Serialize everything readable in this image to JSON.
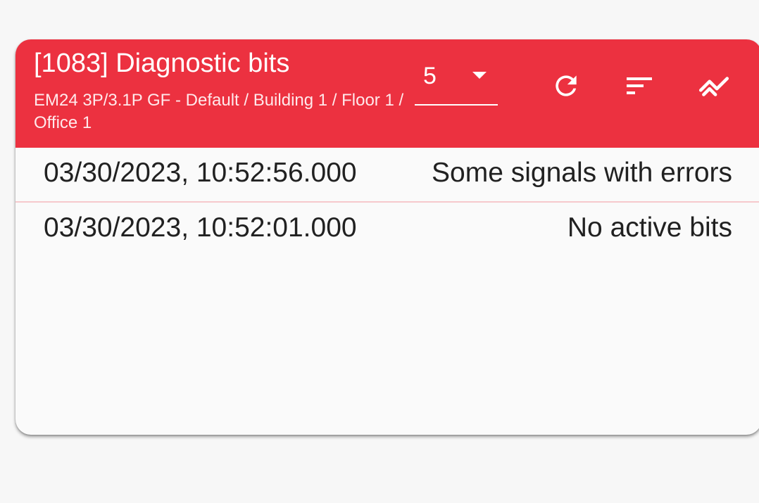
{
  "widget": {
    "title": "[1083] Diagnostic bits",
    "subtitle": "EM24 3P/3.1P GF - Default / Building 1 / Floor 1 / Office 1",
    "header_color": "#ec3140",
    "rows_select": {
      "selected": "5"
    },
    "icons": {
      "refresh": "refresh-icon",
      "sort": "sort-icon",
      "trend": "trend-icon"
    }
  },
  "rows": [
    {
      "timestamp": "03/30/2023, 10:52:56.000",
      "value": "Some signals with errors"
    },
    {
      "timestamp": "03/30/2023, 10:52:01.000",
      "value": "No active bits"
    }
  ]
}
